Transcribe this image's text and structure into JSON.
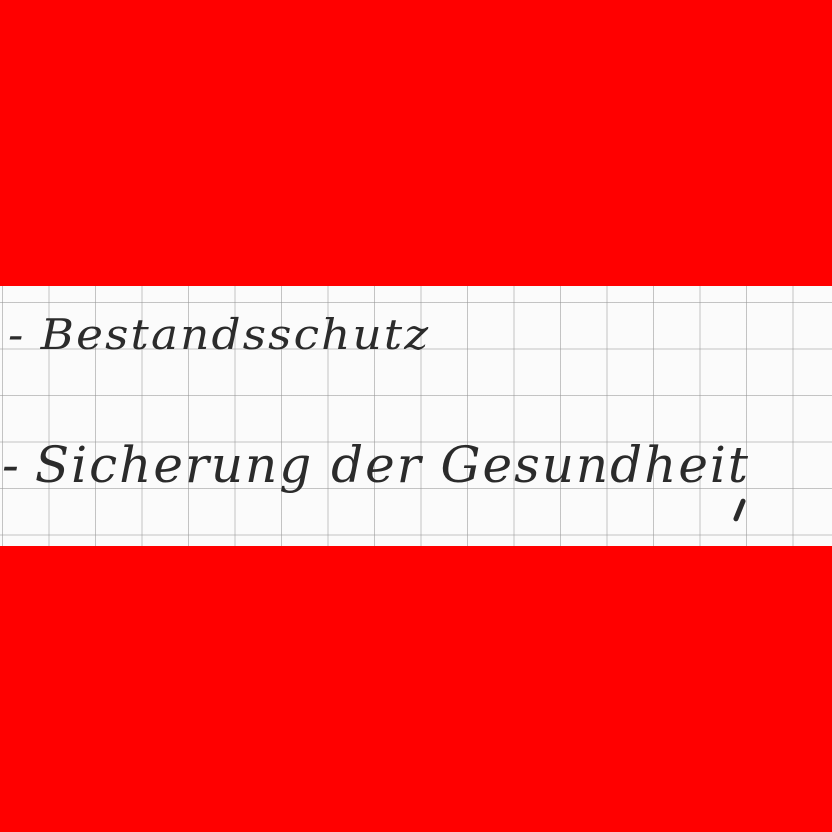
{
  "notes": {
    "items": [
      {
        "bullet": "-",
        "text": "Bestandsschutz"
      },
      {
        "bullet": "-",
        "text": "Sicherung der Gesundheit"
      }
    ]
  },
  "colors": {
    "band": "#ff0000",
    "paper": "#fbfbfb",
    "grid": "#969696",
    "ink": "#2b2b2b"
  }
}
